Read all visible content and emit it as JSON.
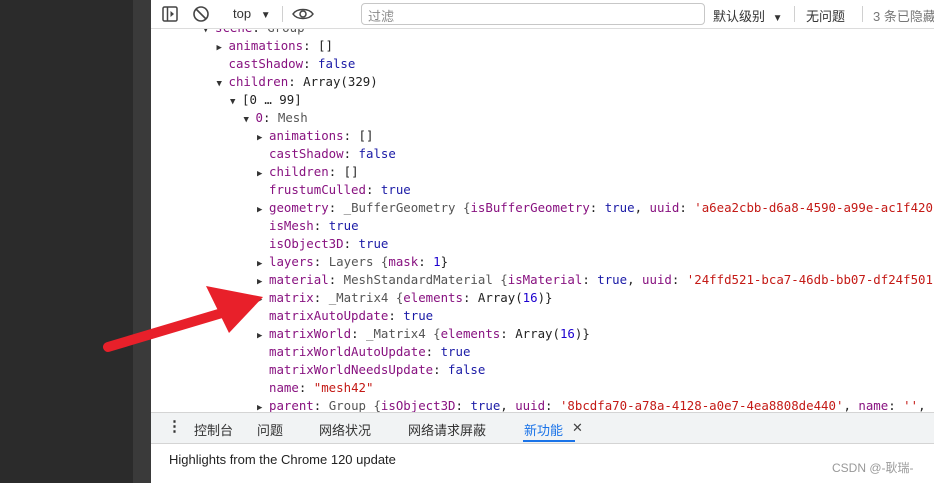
{
  "toolbar": {
    "context": "top",
    "filter_placeholder": "过滤",
    "levels": "默认级别",
    "issues": "无问题",
    "hidden": "3 条已隐藏"
  },
  "console_lines": [
    {
      "indent": 0,
      "tri": "▼",
      "k": "scene",
      "v": "Group",
      "vclass": "type"
    },
    {
      "indent": 1,
      "tri": "▶",
      "k": "animations",
      "v": "[]",
      "vclass": "punc"
    },
    {
      "indent": 1,
      "tri": "",
      "k": "castShadow",
      "v": "false",
      "vclass": "kw"
    },
    {
      "indent": 1,
      "tri": "▼",
      "k": "children",
      "v": "Array(329)",
      "vclass": "punc"
    },
    {
      "indent": 2,
      "tri": "▼",
      "k": "",
      "v": "[0 … 99]",
      "vclass": "punc"
    },
    {
      "indent": 3,
      "tri": "▼",
      "k": "0",
      "v": "Mesh",
      "vclass": "type"
    },
    {
      "indent": 4,
      "tri": "▶",
      "k": "animations",
      "v": "[]",
      "vclass": "punc"
    },
    {
      "indent": 4,
      "tri": "",
      "k": "castShadow",
      "v": "false",
      "vclass": "kw"
    },
    {
      "indent": 4,
      "tri": "▶",
      "k": "children",
      "v": "[]",
      "vclass": "punc"
    },
    {
      "indent": 4,
      "tri": "",
      "k": "frustumCulled",
      "v": "true",
      "vclass": "kw"
    },
    {
      "indent": 4,
      "tri": "▶",
      "k": "geometry",
      "rich": "_BufferGeometry {isBufferGeometry: true, uuid: 'a6ea2cbb-d6a8-4590-a99e-ac1f420"
    },
    {
      "indent": 4,
      "tri": "",
      "k": "isMesh",
      "v": "true",
      "vclass": "kw"
    },
    {
      "indent": 4,
      "tri": "",
      "k": "isObject3D",
      "v": "true",
      "vclass": "kw"
    },
    {
      "indent": 4,
      "tri": "▶",
      "k": "layers",
      "rich": "Layers {mask: 1}"
    },
    {
      "indent": 4,
      "tri": "▶",
      "k": "material",
      "rich": "MeshStandardMaterial {isMaterial: true, uuid: '24ffd521-bca7-46db-bb07-df24f501"
    },
    {
      "indent": 4,
      "tri": "▶",
      "k": "matrix",
      "rich": "_Matrix4 {elements: Array(16)}"
    },
    {
      "indent": 4,
      "tri": "",
      "k": "matrixAutoUpdate",
      "v": "true",
      "vclass": "kw"
    },
    {
      "indent": 4,
      "tri": "▶",
      "k": "matrixWorld",
      "rich": "_Matrix4 {elements: Array(16)}"
    },
    {
      "indent": 4,
      "tri": "",
      "k": "matrixWorldAutoUpdate",
      "v": "true",
      "vclass": "kw"
    },
    {
      "indent": 4,
      "tri": "",
      "k": "matrixWorldNeedsUpdate",
      "v": "false",
      "vclass": "kw"
    },
    {
      "indent": 4,
      "tri": "",
      "k": "name",
      "v": "\"mesh42\"",
      "vclass": "str"
    },
    {
      "indent": 4,
      "tri": "▶",
      "k": "parent",
      "rich": "Group {isObject3D: true, uuid: '8bcdfa70-a78a-4128-a0e7-4ea8808de440', name: '', "
    }
  ],
  "bottom_tabs": {
    "console": "控制台",
    "issues": "问题",
    "network": "网络状况",
    "blocking": "网络请求屏蔽",
    "whatsnew": "新功能"
  },
  "highlights": "Highlights from the Chrome 120 update",
  "watermark": "CSDN @-耿瑞-"
}
